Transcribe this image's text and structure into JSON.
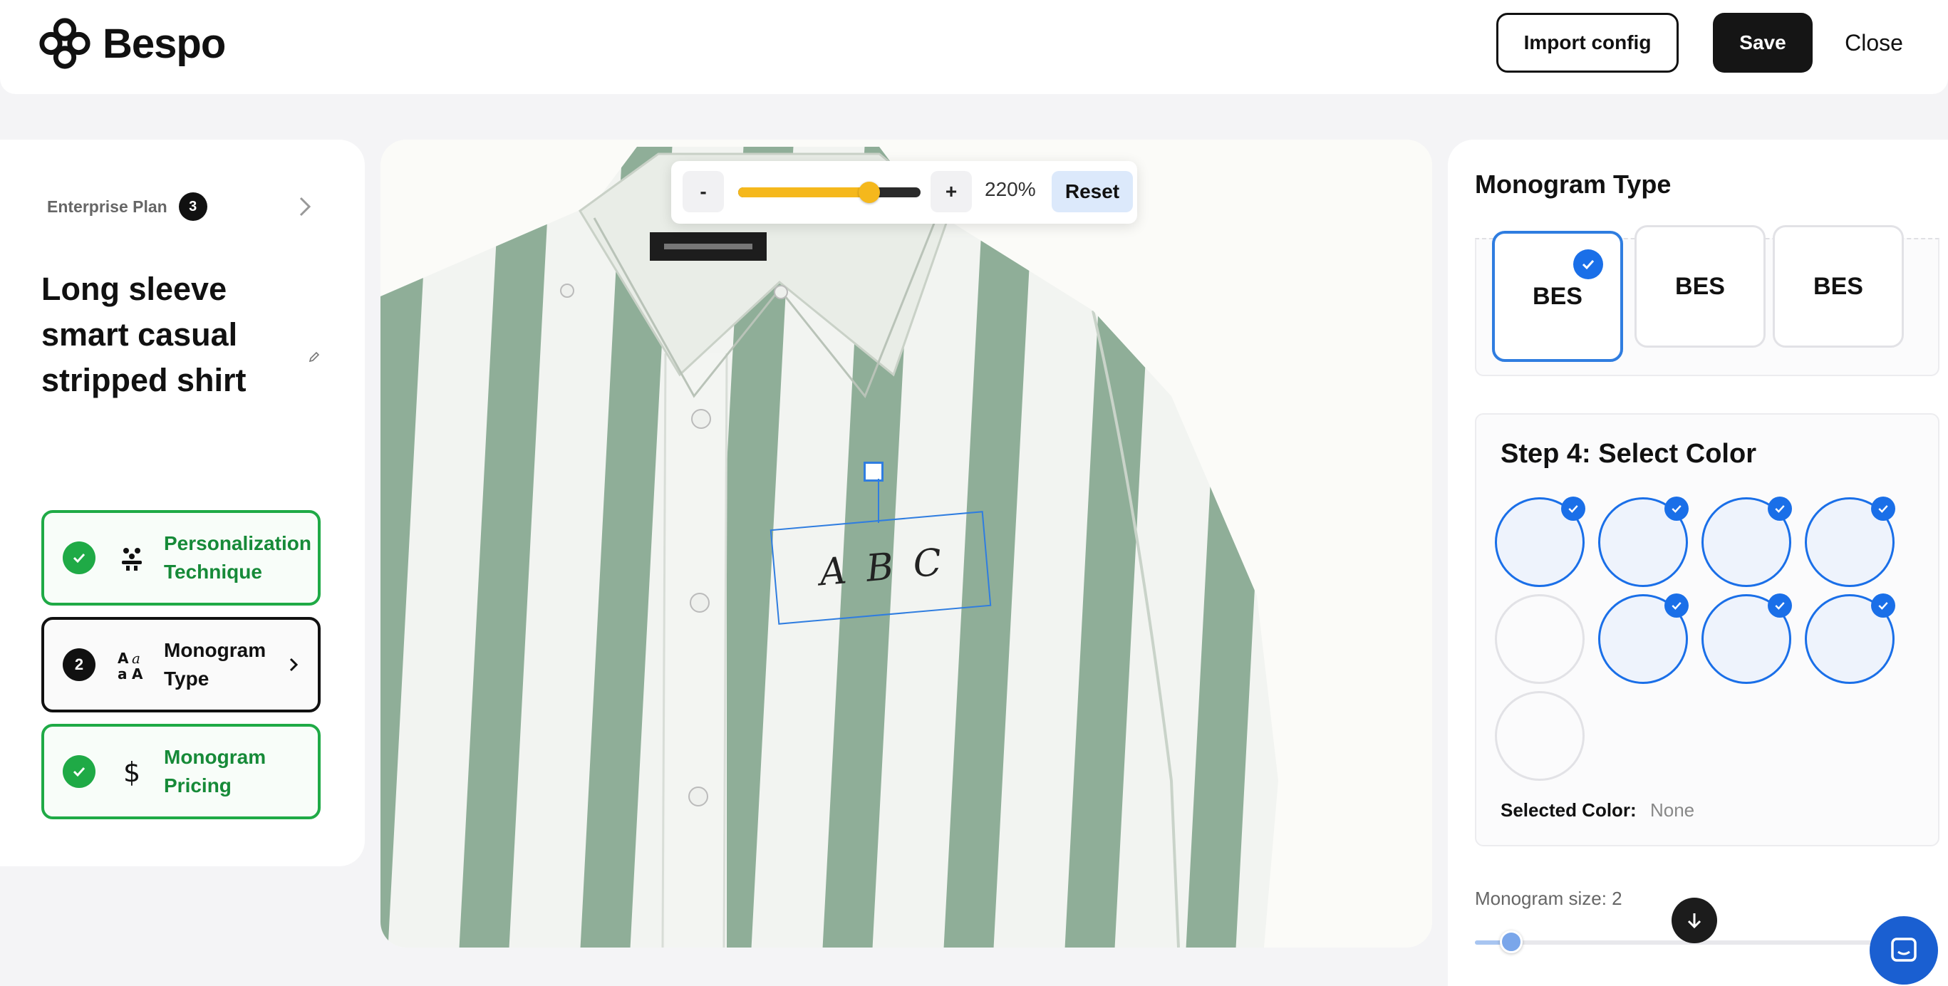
{
  "app": {
    "name": "Bespo"
  },
  "header": {
    "import_label": "Import config",
    "save_label": "Save",
    "close_label": "Close"
  },
  "sidebar": {
    "plan_label": "Enterprise Plan",
    "plan_count": "3",
    "product_title": "Long sleeve smart casual stripped shirt",
    "steps": [
      {
        "label": "Personalization Technique",
        "status": "done",
        "icon": "tools-icon"
      },
      {
        "label": "Monogram Type",
        "status": "active",
        "number": "2",
        "icon": "font-case-icon"
      },
      {
        "label": "Monogram Pricing",
        "status": "done",
        "icon": "dollar-icon"
      }
    ]
  },
  "canvas": {
    "zoom": {
      "minus_label": "-",
      "plus_label": "+",
      "value_label": "220%",
      "level": 0.72,
      "reset_label": "Reset"
    },
    "monogram_text": [
      "A",
      "B",
      "C"
    ],
    "colors": {
      "shirt_stripe": "#8fae98",
      "shirt_white": "#f2f4f1"
    }
  },
  "panel": {
    "monogram_type_heading": "Monogram Type",
    "type_options": [
      {
        "label": "BES",
        "selected": true
      },
      {
        "label": "BES",
        "selected": false
      },
      {
        "label": "BES",
        "selected": false
      }
    ],
    "color_step_title": "Step 4: Select Color",
    "swatches": [
      {
        "checked": true
      },
      {
        "checked": true
      },
      {
        "checked": true
      },
      {
        "checked": true
      },
      {
        "checked": false
      },
      {
        "checked": true
      },
      {
        "checked": true
      },
      {
        "checked": true
      },
      {
        "checked": false
      }
    ],
    "selected_color_label": "Selected Color:",
    "selected_color_value": "None",
    "size_label": "Monogram size: 2",
    "size_level": 0.08
  },
  "theme": {
    "accent": "#1a6fe8",
    "success": "#1faa46",
    "zoom_fill": "#f5b81c",
    "dark": "#151515"
  }
}
